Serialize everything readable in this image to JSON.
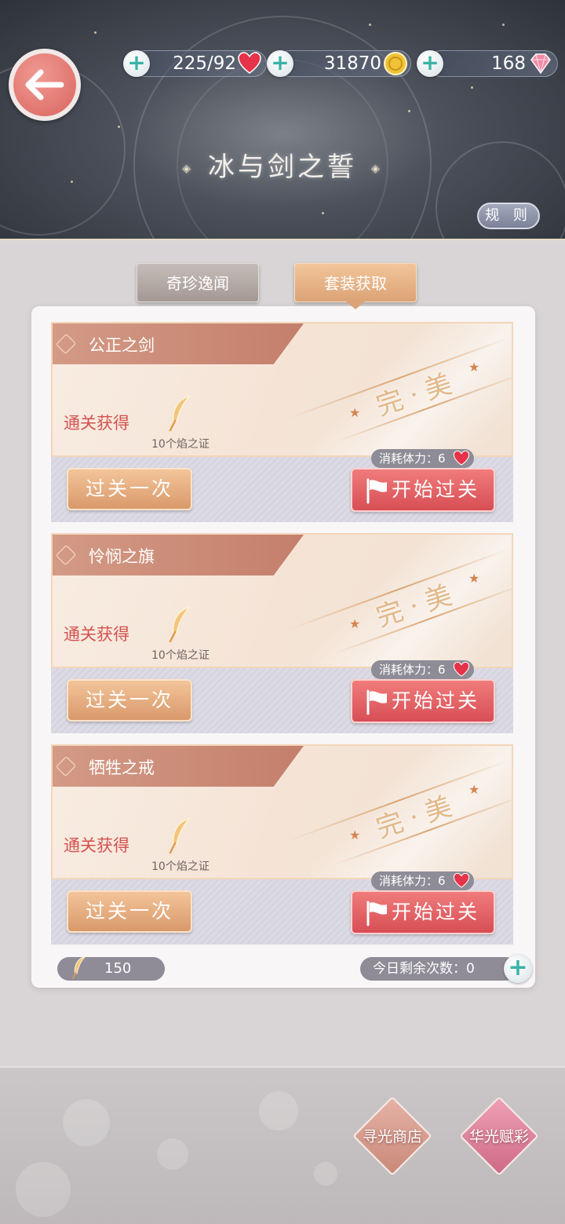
{
  "header": {
    "title": "冰与剑之誓",
    "rules_label": "规 则",
    "stamina": "225/92",
    "gold": "31870",
    "diamonds": "168",
    "plus_label": "+"
  },
  "tabs": [
    {
      "label": "奇珍逸闻",
      "active": false
    },
    {
      "label": "套装获取",
      "active": true
    }
  ],
  "stages": [
    {
      "name": "公正之剑",
      "perfect_label": "完·美",
      "reward_label": "通关获得",
      "reward_caption": "10个焰之证",
      "cost_label": "消耗体力：6",
      "once_button": "过关一次",
      "start_button": "开始过关"
    },
    {
      "name": "怜悯之旗",
      "perfect_label": "完·美",
      "reward_label": "通关获得",
      "reward_caption": "10个焰之证",
      "cost_label": "消耗体力：6",
      "once_button": "过关一次",
      "start_button": "开始过关"
    },
    {
      "name": "牺牲之戒",
      "perfect_label": "完·美",
      "reward_label": "通关获得",
      "reward_caption": "10个焰之证",
      "cost_label": "消耗体力：6",
      "once_button": "过关一次",
      "start_button": "开始过关"
    }
  ],
  "footer": {
    "feather_count": "150",
    "remaining_label": "今日剩余次数：0",
    "plus_label": "+"
  },
  "bottom_bar": {
    "shop_label": "寻光商店",
    "gacha_label": "华光赋彩"
  },
  "colors": {
    "accent_red": "#d74e55",
    "accent_gold": "#d9996a",
    "teal_plus": "#3ab3a7"
  },
  "icons": [
    "back-arrow-icon",
    "heart-icon",
    "gold-coin-icon",
    "diamond-icon",
    "feather-icon",
    "flag-icon",
    "plus-icon"
  ]
}
